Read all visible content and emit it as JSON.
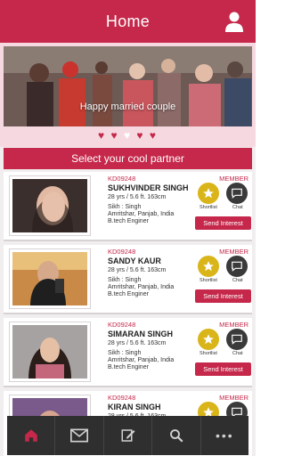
{
  "header": {
    "title": "Home",
    "user_icon": "user-icon"
  },
  "banner": {
    "caption": "Happy married couple",
    "hearts": [
      "on",
      "on",
      "off",
      "on",
      "on"
    ]
  },
  "section": {
    "title": "Select your cool partner"
  },
  "cards": [
    {
      "id": "KD09248",
      "badge": "MEMBER",
      "name": "SUKHVINDER SINGH",
      "meta": "28 yrs / 5.6 ft. 163cm",
      "religion": "Sikh : Singh",
      "place": "Amritshar, Panjab, India",
      "edu": "B.tech Enginer",
      "shortlist": "Shortlist",
      "chat": "Chat",
      "send": "Send Interest"
    },
    {
      "id": "KD09248",
      "badge": "MEMBER",
      "name": "SANDY KAUR",
      "meta": "28 yrs / 5.6 ft. 163cm",
      "religion": "Sikh : Singh",
      "place": "Amritshar, Panjab, India",
      "edu": "B.tech Enginer",
      "shortlist": "Shortlist",
      "chat": "Chat",
      "send": "Send Interest"
    },
    {
      "id": "KD09248",
      "badge": "MEMBER",
      "name": "SIMARAN SINGH",
      "meta": "28 yrs / 5.6 ft. 163cm",
      "religion": "Sikh : Singh",
      "place": "Amritshar, Panjab, India",
      "edu": "B.tech Enginer",
      "shortlist": "Shortlist",
      "chat": "Chat",
      "send": "Send Interest"
    },
    {
      "id": "KD09248",
      "badge": "MEMBER",
      "name": "KIRAN SINGH",
      "meta": "28 yrs / 5.6 ft. 163cm",
      "religion": "",
      "place": "",
      "edu": "",
      "shortlist": "Shortlist",
      "chat": "Chat",
      "send": ""
    }
  ],
  "bottom_nav": [
    "home-icon",
    "mail-icon",
    "edit-icon",
    "search-icon",
    "more-icon"
  ],
  "colors": {
    "primary": "#c5284a",
    "star": "#d9b51a",
    "chat": "#3a3a3a",
    "nav": "#2f2f2f"
  }
}
